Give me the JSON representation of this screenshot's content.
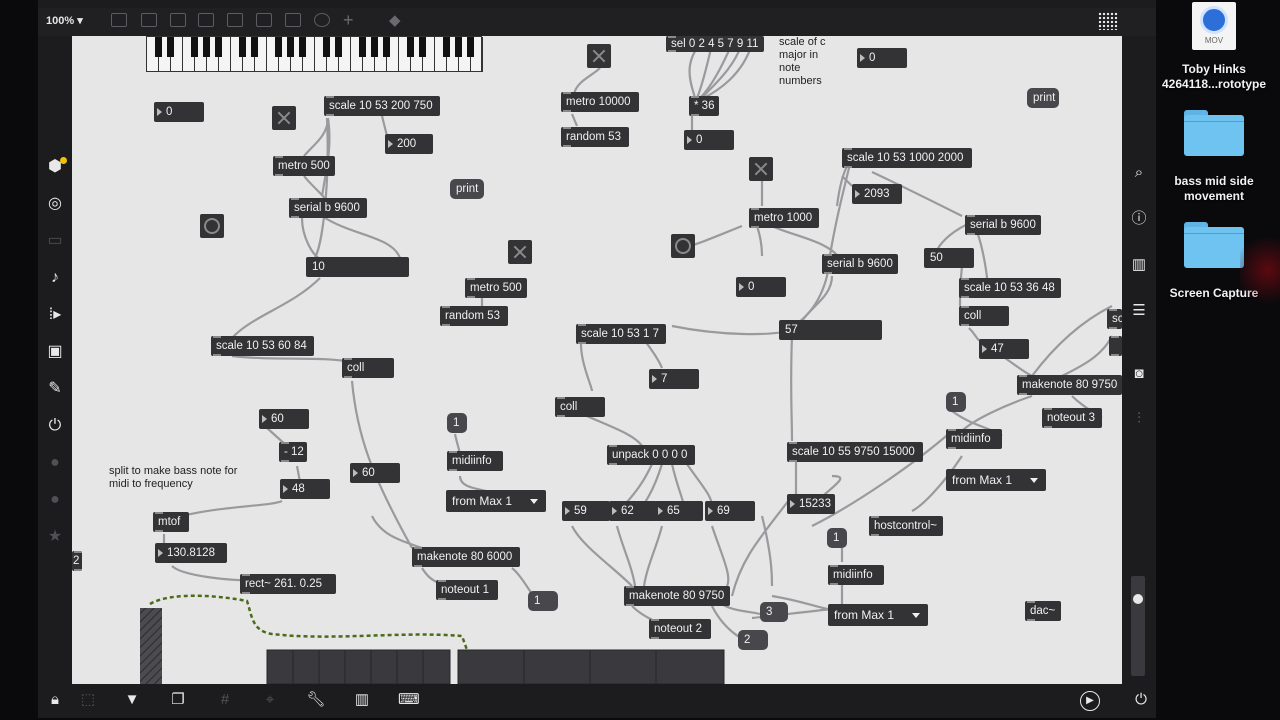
{
  "toolbar": {
    "zoom": "100%"
  },
  "desktop": {
    "mov_badge": "MOV",
    "mov_label": "Toby Hinks 4264118...rototype",
    "folder1_label": "bass mid side movement",
    "folder2_label": "Screen Capture"
  },
  "patch": {
    "number_boxes": {
      "n_top_left": "0",
      "n_200": "200",
      "n_top_mid": "0",
      "n_top_right": "0",
      "n_2093": "2093",
      "n_mid": "0",
      "n_60a": "60",
      "n_48": "48",
      "n_130": "130.8128",
      "n_60b": "60",
      "n_7": "7",
      "n_59": "59",
      "n_62": "62",
      "n_65": "65",
      "n_69": "69",
      "n_15233": "15233",
      "n_47": "47"
    },
    "objects": {
      "scale_10_53_200_750": "scale 10 53 200 750",
      "metro_500_a": "metro 500",
      "serial_b_a": "serial b 9600",
      "box_10": "10",
      "scale_10_53_60_84": "scale 10 53 60 84",
      "coll_a": "coll",
      "minus_12": "- 12",
      "mtof": "mtof",
      "rect": "rect~ 261. 0.25",
      "metro_500_b": "metro 500",
      "random_53_a": "random 53",
      "midiinfo_a": "midiinfo",
      "makenote_80_6000": "makenote 80 6000",
      "noteout_1": "noteout 1",
      "metro_10000": "metro 10000",
      "random_53_b": "random 53",
      "sel": "sel 0 2 4 5 7 9 11",
      "mul_36": "* 36",
      "scale_10_53_1_7": "scale 10 53 1 7",
      "coll_b": "coll",
      "unpack": "unpack 0 0 0 0",
      "makenote_80_9750_a": "makenote 80 9750",
      "noteout_2": "noteout 2",
      "metro_1000": "metro 1000",
      "serial_b_b": "serial b 9600",
      "box_57": "57",
      "scale_10_55_9750_15000": "scale 10 55 9750 15000",
      "hostcontrol": "hostcontrol~",
      "midiinfo_b": "midiinfo",
      "scale_10_53_1000_2000": "scale 10 53 1000 2000",
      "serial_b_c": "serial b 9600",
      "box_50": "50",
      "scale_10_53_36_48": "scale 10 53 36 48",
      "coll_c": "coll",
      "makenote_80_9750_b": "makenote 80 9750",
      "noteout_3": "noteout 3",
      "midiinfo_c": "midiinfo",
      "dac": "dac~",
      "clip_sc": "sc",
      "clip_2": "2"
    },
    "messages": {
      "print_a": "print",
      "print_b": "print",
      "msg_1a": "1",
      "msg_1b": "1",
      "msg_1c": "1",
      "msg_1d": "1",
      "msg_3": "3",
      "msg_2": "2"
    },
    "menus": {
      "from_max_a": "from Max 1",
      "from_max_b": "from Max 1",
      "from_max_c": "from Max 1"
    },
    "comments": {
      "scale_c_major": "scale of c major in note numbers",
      "split_bass": "split to make bass note for midi to frequency"
    }
  }
}
